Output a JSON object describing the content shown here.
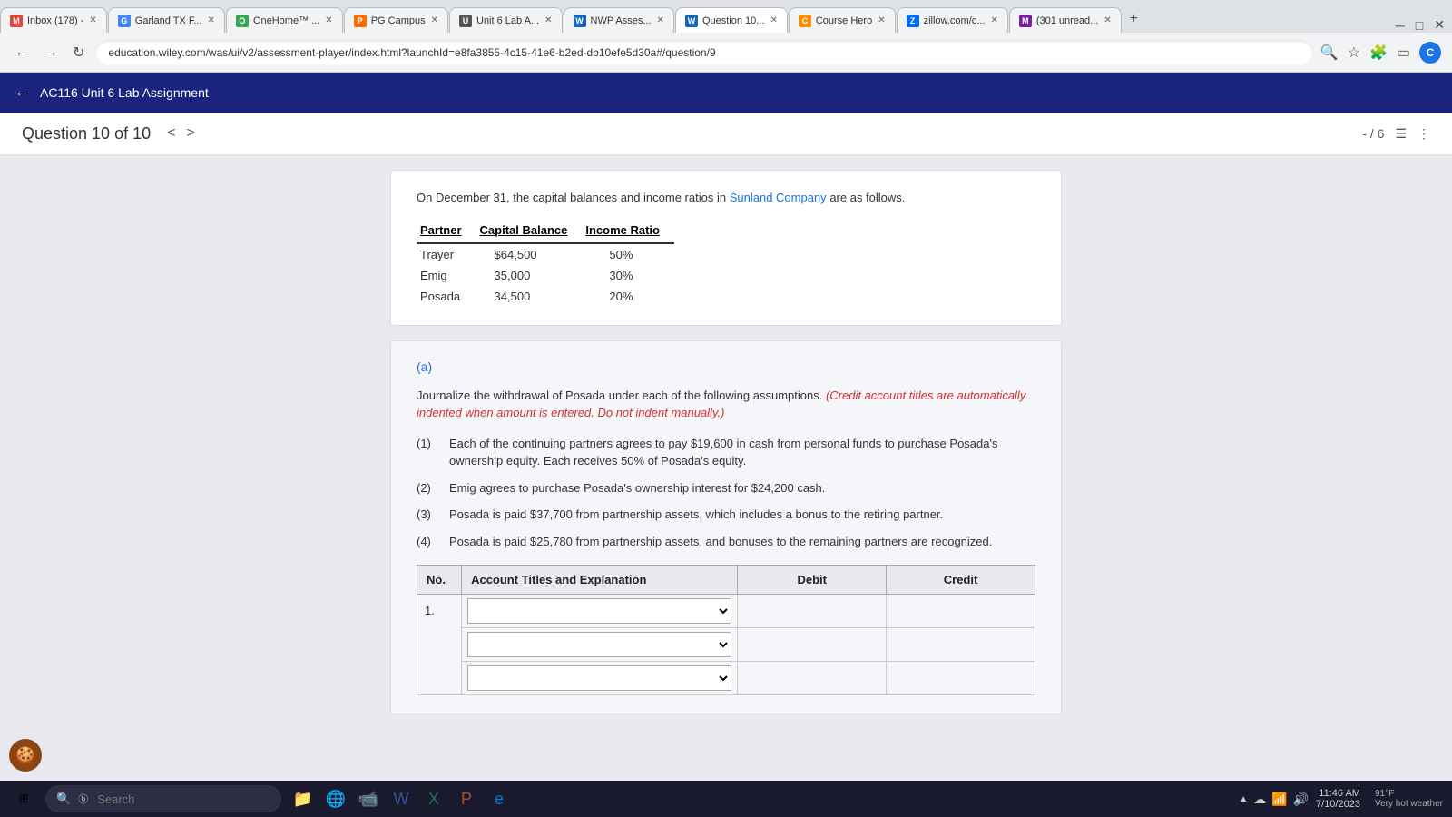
{
  "browser": {
    "tabs": [
      {
        "id": "gmail",
        "label": "Inbox (178) -",
        "favicon_color": "#EA4335",
        "favicon_letter": "M",
        "active": false
      },
      {
        "id": "garland",
        "label": "Garland TX F...",
        "favicon_color": "#4285F4",
        "favicon_letter": "G",
        "active": false
      },
      {
        "id": "onehome",
        "label": "OneHome™ ...",
        "favicon_color": "#34A853",
        "favicon_letter": "O",
        "active": false
      },
      {
        "id": "pgcampus",
        "label": "PG Campus",
        "favicon_color": "#FF6D00",
        "favicon_letter": "P",
        "active": false
      },
      {
        "id": "unit6lab",
        "label": "Unit 6 Lab A...",
        "favicon_color": "#555",
        "favicon_letter": "U",
        "active": false
      },
      {
        "id": "nwp",
        "label": "NWP Asses...",
        "favicon_color": "#1565C0",
        "favicon_letter": "W",
        "active": false
      },
      {
        "id": "question10",
        "label": "Question 10...",
        "favicon_color": "#1565C0",
        "favicon_letter": "W",
        "active": true
      },
      {
        "id": "coursehero",
        "label": "Course Hero",
        "favicon_color": "#FF8F00",
        "favicon_letter": "C",
        "active": false
      },
      {
        "id": "zillow",
        "label": "zillow.com/c...",
        "favicon_color": "#006AFF",
        "favicon_letter": "Z",
        "active": false
      },
      {
        "id": "301unread",
        "label": "(301 unread...",
        "favicon_color": "#7B1FA2",
        "favicon_letter": "M",
        "active": false
      }
    ],
    "address": "education.wiley.com/was/ui/v2/assessment-player/index.html?launchId=e8fa3855-4c15-41e6-b2ed-db10efe5d30a#/question/9",
    "profile_letter": "C"
  },
  "app_header": {
    "back_label": "←",
    "title": "AC116 Unit 6 Lab Assignment"
  },
  "question_nav": {
    "title": "Question 10 of 10",
    "page_indicator": "- / 6",
    "prev_arrow": "<",
    "next_arrow": ">"
  },
  "info_section": {
    "intro_text": "On December 31, the capital balances and income ratios in",
    "company_name": "Sunland Company",
    "intro_text2": "are as follows.",
    "table": {
      "headers": [
        "Partner",
        "Capital Balance",
        "Income Ratio"
      ],
      "rows": [
        {
          "partner": "Trayer",
          "capital": "$64,500",
          "ratio": "50%"
        },
        {
          "partner": "Emig",
          "capital": "35,000",
          "ratio": "30%"
        },
        {
          "partner": "Posada",
          "capital": "34,500",
          "ratio": "20%"
        }
      ]
    }
  },
  "section_a": {
    "label": "(a)",
    "instruction_plain": "Journalize the withdrawal of Posada under each of the following assumptions.",
    "instruction_italic": "(Credit account titles are automatically indented when amount is entered. Do not indent manually.)",
    "assumptions": [
      {
        "num": "(1)",
        "text": "Each of the continuing partners agrees to pay $19,600 in cash from personal funds to purchase Posada's ownership equity. Each receives 50% of Posada's equity."
      },
      {
        "num": "(2)",
        "text": "Emig agrees to purchase Posada's ownership interest for $24,200 cash."
      },
      {
        "num": "(3)",
        "text": "Posada is paid $37,700 from partnership assets, which includes a bonus to the retiring partner."
      },
      {
        "num": "(4)",
        "text": "Posada is paid $25,780 from partnership assets, and bonuses to the remaining partners are recognized."
      }
    ]
  },
  "journal_table": {
    "headers": [
      "No.",
      "Account Titles and Explanation",
      "Debit",
      "Credit"
    ],
    "row_no": "1.",
    "rows": [
      {
        "select_val": "",
        "debit": "",
        "credit": ""
      },
      {
        "select_val": "",
        "debit": "",
        "credit": ""
      },
      {
        "select_val": "",
        "debit": "",
        "credit": ""
      }
    ]
  },
  "taskbar": {
    "search_placeholder": "Search",
    "search_icon": "🔍",
    "time": "11:46 AM",
    "date": "7/10/2023",
    "start_icon": "⊞",
    "temp": "91°F",
    "weather": "Very hot weather"
  }
}
